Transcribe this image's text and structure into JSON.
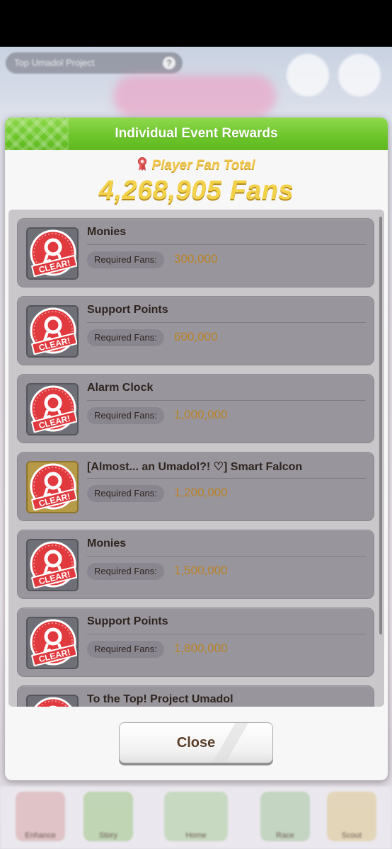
{
  "background": {
    "header_title": "Top Umadol Project",
    "help_symbol": "?",
    "nav_labels": [
      "Enhance",
      "Story",
      "Home",
      "Race",
      "Scout"
    ]
  },
  "modal": {
    "title": "Individual Event Rewards",
    "fan_total_label": "Player Fan Total",
    "fan_total_value": "4,268,905 Fans",
    "required_label": "Required Fans:",
    "clear_text": "CLEAR!",
    "rewards": [
      {
        "name": "Monies",
        "required": "300,000",
        "status": "CLEAR!"
      },
      {
        "name": "Support Points",
        "required": "600,000",
        "status": "CLEAR!"
      },
      {
        "name": "Alarm Clock",
        "required": "1,000,000",
        "status": "CLEAR!"
      },
      {
        "name": "[Almost... an Umadol?! ♡] Smart Falcon",
        "required": "1,200,000",
        "status": "CLEAR!"
      },
      {
        "name": "Monies",
        "required": "1,500,000",
        "status": "CLEAR!"
      },
      {
        "name": "Support Points",
        "required": "1,800,000",
        "status": "CLEAR!"
      },
      {
        "name": "To the Top! Project Umadol",
        "required": "",
        "status": "CLEAR!"
      }
    ],
    "close_label": "Close"
  },
  "colors": {
    "header_green": "#6cc52a",
    "gold_text": "#f3d24b",
    "stamp_red": "#e0393e"
  },
  "icons": [
    "ribbon-icon",
    "clear-stamp-icon"
  ]
}
